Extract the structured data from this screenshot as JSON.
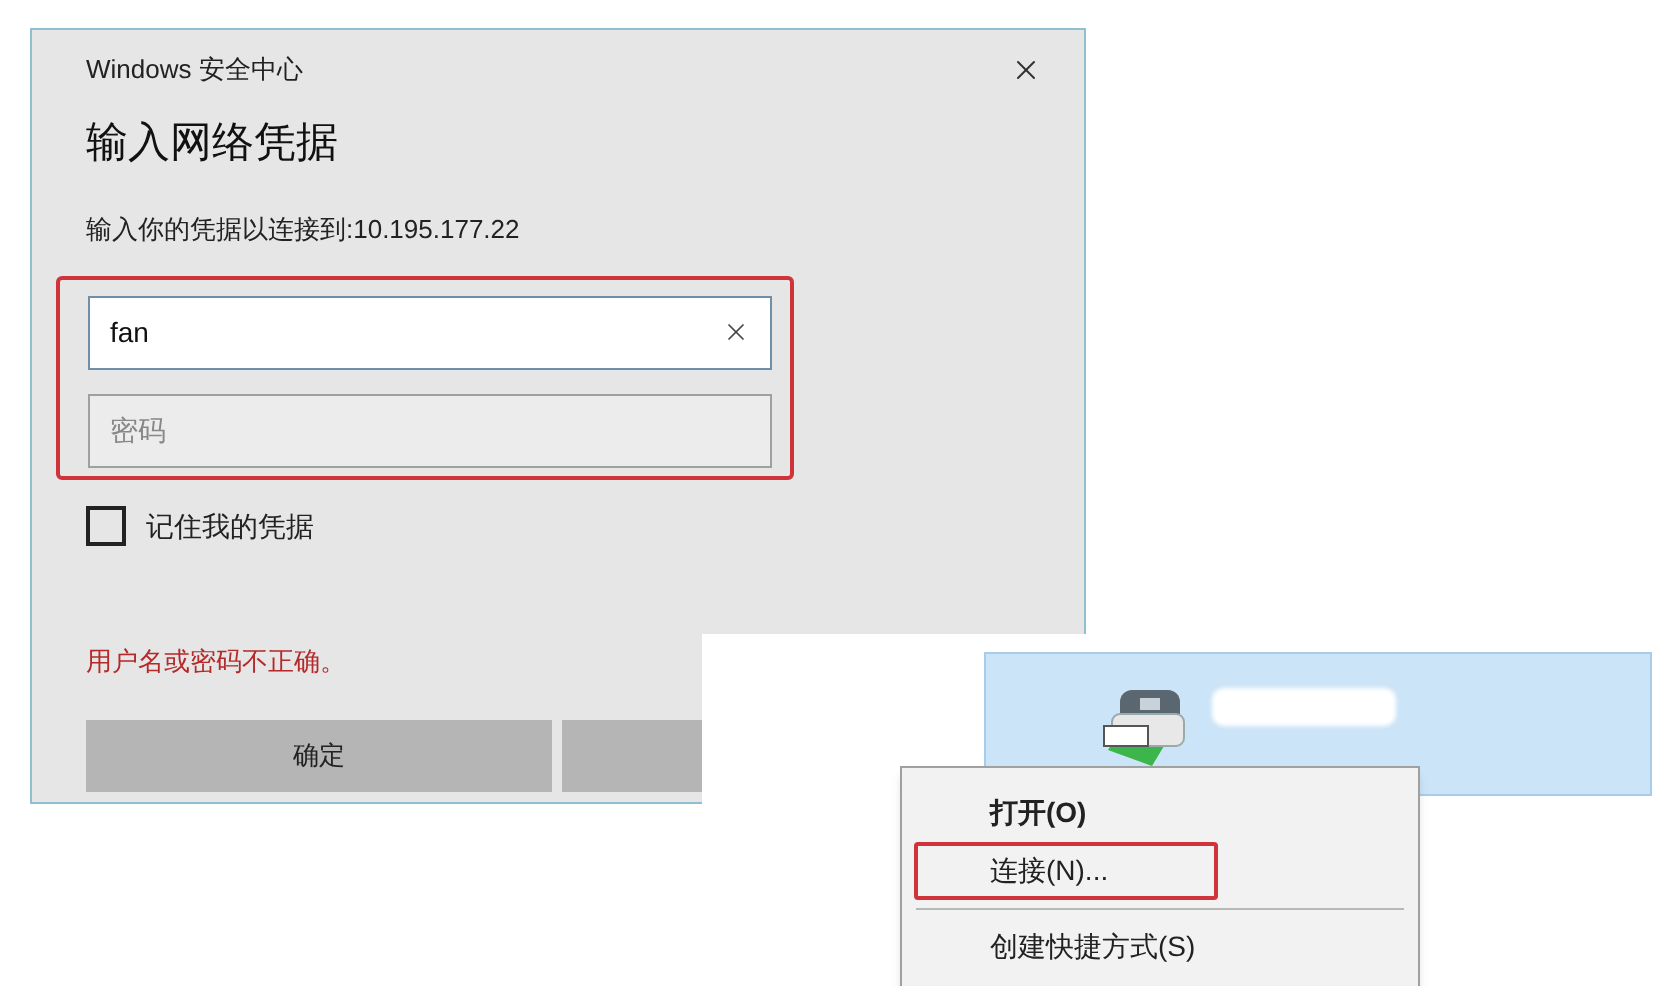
{
  "window": {
    "title": "Windows 安全中心"
  },
  "heading": "输入网络凭据",
  "prompt": "输入你的凭据以连接到:10.195.177.22",
  "credentials_highlighted": true,
  "username": {
    "value": "fan",
    "focused": true
  },
  "password": {
    "placeholder": "密码"
  },
  "remember": {
    "label": "记住我的凭据",
    "checked": false
  },
  "error": "用户名或密码不正确。",
  "buttons": [
    {
      "label": "确定"
    }
  ],
  "device": {
    "selected": true
  },
  "context_menu": {
    "items": [
      {
        "label": "打开(O)",
        "kind": "default",
        "highlighted": false
      },
      {
        "label": "连接(N)...",
        "kind": "normal",
        "highlighted": true
      },
      {
        "label": "创建快捷方式(S)",
        "kind": "normal",
        "highlighted": false
      }
    ]
  }
}
